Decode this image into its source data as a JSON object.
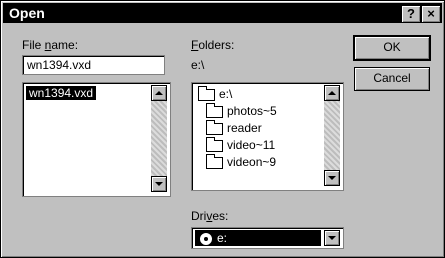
{
  "window": {
    "title": "Open"
  },
  "titlebar": {
    "help": "?",
    "close": "×"
  },
  "file": {
    "label_before": "File ",
    "label_accel": "n",
    "label_after": "ame:",
    "value": "wn1394.vxd",
    "list": [
      "wn1394.vxd"
    ]
  },
  "folders": {
    "label_accel": "F",
    "label_after": "olders:",
    "current_path": "e:\\",
    "items": [
      "e:\\",
      "photos~5",
      "reader",
      "video~11",
      "videon~9"
    ]
  },
  "drives": {
    "label_before": "Dri",
    "label_accel": "v",
    "label_after": "es:",
    "selected": "e:"
  },
  "buttons": {
    "ok": "OK",
    "cancel": "Cancel"
  }
}
